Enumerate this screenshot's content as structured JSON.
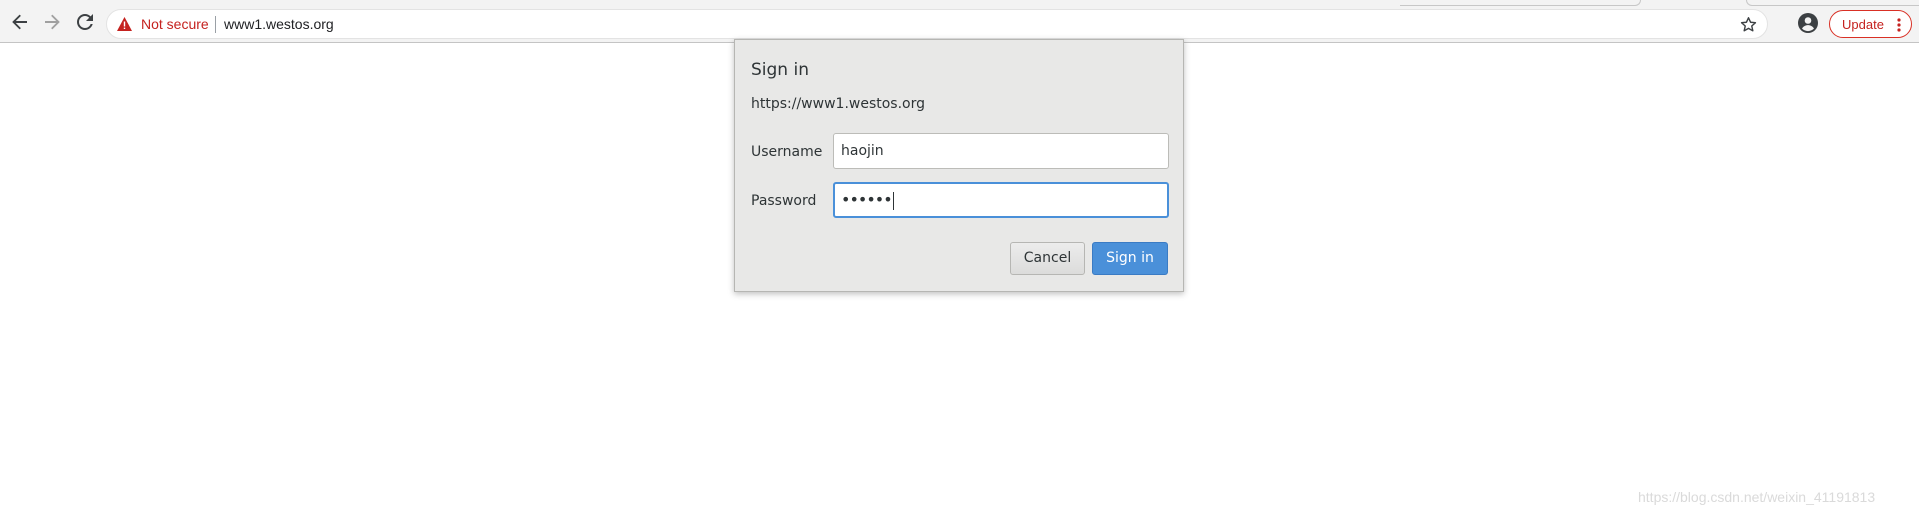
{
  "browser": {
    "security_label": "Not secure",
    "url": "www1.westos.org",
    "update_label": "Update",
    "icons": {
      "back": "back-arrow-icon",
      "forward": "forward-arrow-icon",
      "reload": "reload-icon",
      "warning": "warning-triangle-icon",
      "bookmark": "star-icon",
      "account": "account-circle-icon",
      "menu": "kebab-menu-icon"
    },
    "colors": {
      "warning": "#c5221f",
      "update_border": "#d93025"
    }
  },
  "dialog": {
    "title": "Sign in",
    "origin": "https://www1.westos.org",
    "username_label": "Username",
    "username_value": "haojin",
    "password_label": "Password",
    "password_value": "••••••",
    "cancel_label": "Cancel",
    "submit_label": "Sign in",
    "colors": {
      "submit_bg": "#4a90d9",
      "focus_ring": "#4a90d9"
    }
  },
  "watermark": "https://blog.csdn.net/weixin_41191813"
}
